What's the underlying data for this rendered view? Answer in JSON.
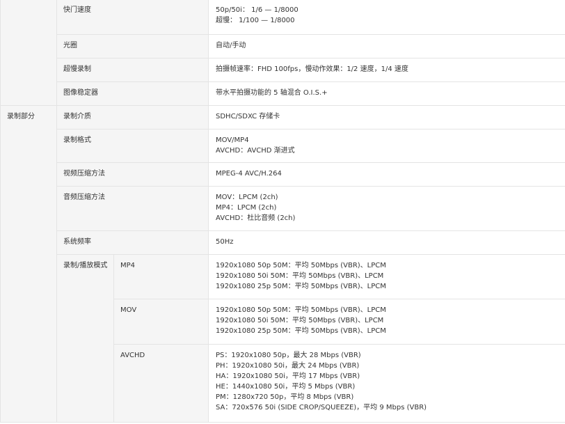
{
  "rows": [
    {
      "label": "快门速度",
      "lines": [
        "50p/50i： 1/6 — 1/8000",
        "超慢： 1/100 — 1/8000"
      ]
    },
    {
      "label": "光圈",
      "lines": [
        "自动/手动"
      ]
    },
    {
      "label": "超慢录制",
      "lines": [
        "拍摄帧速率：FHD 100fps，慢动作效果：1/2 速度，1/4 速度"
      ]
    },
    {
      "label": "图像稳定器",
      "lines": [
        "带水平拍摄功能的 5 轴混合 O.I.S.+"
      ]
    },
    {
      "category": "录制部分",
      "label": "录制介质",
      "lines": [
        "SDHC/SDXC 存储卡"
      ]
    },
    {
      "label": "录制格式",
      "lines": [
        "MOV/MP4",
        "AVCHD：AVCHD 渐进式"
      ]
    },
    {
      "label": "视频压缩方法",
      "lines": [
        "MPEG-4 AVC/H.264"
      ]
    },
    {
      "label": "音频压缩方法",
      "lines": [
        "MOV：LPCM (2ch)",
        "MP4：LPCM (2ch)",
        "AVCHD：杜比音频 (2ch)"
      ]
    },
    {
      "label": "系统频率",
      "lines": [
        "50Hz"
      ]
    }
  ],
  "mode": {
    "label": "录制/播放模式",
    "items": [
      {
        "label": "MP4",
        "lines": [
          "1920x1080 50p 50M：平均 50Mbps (VBR)、LPCM",
          "1920x1080 50i 50M：平均 50Mbps (VBR)、LPCM",
          "1920x1080 25p 50M：平均 50Mbps (VBR)、LPCM"
        ]
      },
      {
        "label": "MOV",
        "lines": [
          "1920x1080 50p 50M：平均 50Mbps (VBR)、LPCM",
          "1920x1080 50i 50M：平均 50Mbps (VBR)、LPCM",
          "1920x1080 25p 50M：平均 50Mbps (VBR)、LPCM"
        ]
      },
      {
        "label": "AVCHD",
        "lines": [
          "PS：1920x1080 50p，最大 28 Mbps (VBR)",
          "PH：1920x1080 50i，最大 24 Mbps (VBR)",
          "HA：1920x1080 50i，平均 17 Mbps (VBR)",
          "HE：1440x1080 50i，平均 5 Mbps (VBR)",
          "PM：1280x720 50p，平均 8 Mbps (VBR)",
          "SA：720x576 50i (SIDE CROP/SQUEEZE)，平均 9 Mbps (VBR)"
        ]
      }
    ]
  }
}
